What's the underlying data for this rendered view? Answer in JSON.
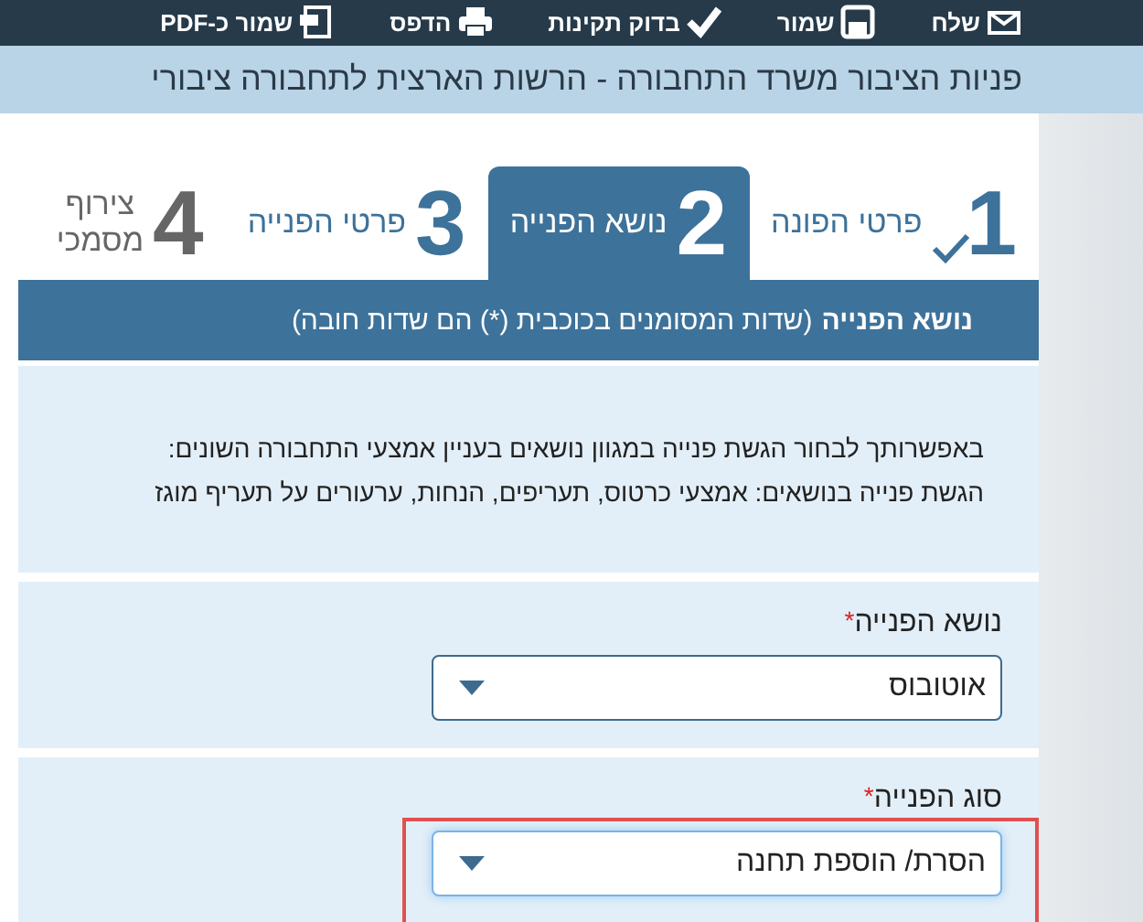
{
  "toolbar": [
    {
      "kind": "send",
      "label": "שלח"
    },
    {
      "kind": "save",
      "label": "שמור"
    },
    {
      "kind": "validate",
      "label": "בדוק תקינות"
    },
    {
      "kind": "print",
      "label": "הדפס"
    },
    {
      "kind": "pdf",
      "label": "שמור כ-PDF"
    }
  ],
  "title": "פניות הציבור משרד התחבורה - הרשות הארצית לתחבורה ציבורי",
  "steps": [
    {
      "number": "1",
      "lines": [
        "פרטי הפונה"
      ],
      "completed": true,
      "disabled": false,
      "selected": false
    },
    {
      "number": "2",
      "lines": [
        "נושא הפנייה"
      ],
      "completed": false,
      "disabled": false,
      "selected": true
    },
    {
      "number": "3",
      "lines": [
        "פרטי הפנייה"
      ],
      "completed": false,
      "disabled": false,
      "selected": false
    },
    {
      "number": "4",
      "lines": [
        "צירוף",
        "מסמכי"
      ],
      "completed": false,
      "disabled": true,
      "selected": false
    }
  ],
  "section_title": "נושא הפנייה",
  "section_note": "(שדות המסומנים בכוכבית (*) הם שדות חובה)",
  "info_lines": [
    "באפשרותך לבחור הגשת פנייה במגוון נושאים בעניין אמצעי התחבורה השונים:",
    "הגשת פנייה בנושאים: אמצעי כרטוס, תעריפים, הנחות, ערעורים על תעריף מוגז"
  ],
  "fields": [
    {
      "label": "נושא הפנייה",
      "required_mark": "*",
      "value": "אוטובוס",
      "focused": false,
      "highlighted": false
    },
    {
      "label": "סוג הפנייה",
      "required_mark": "*",
      "value": "הסרת/ הוספת תחנה",
      "focused": true,
      "highlighted": true
    }
  ]
}
